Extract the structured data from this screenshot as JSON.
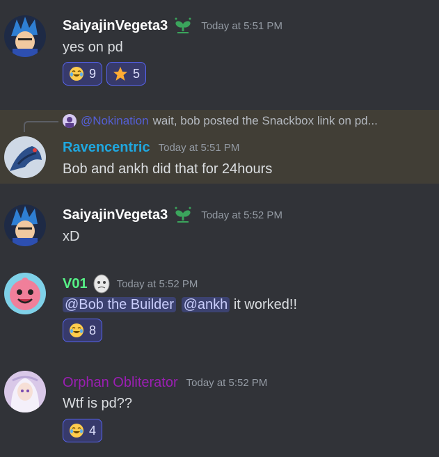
{
  "messages": [
    {
      "username": "SaiyajinVegeta3",
      "timestamp": "Today at 5:51 PM",
      "content": "yes on pd",
      "reactions": [
        {
          "emoji": "joy-emoji",
          "count": "9"
        },
        {
          "emoji": "star-emoji",
          "count": "5"
        }
      ]
    },
    {
      "reply": {
        "mention": "@Nokination",
        "text": "wait, bob posted the Snackbox link on pd..."
      },
      "username": "Ravencentric",
      "timestamp": "Today at 5:51 PM",
      "content": "Bob and ankh did that for 24hours"
    },
    {
      "username": "SaiyajinVegeta3",
      "timestamp": "Today at 5:52 PM",
      "content": "xD"
    },
    {
      "username": "V01",
      "timestamp": "Today at 5:52 PM",
      "mentions": [
        "@Bob the Builder",
        "@ankh"
      ],
      "content": "it worked!!",
      "reactions": [
        {
          "emoji": "joy-emoji",
          "count": "8"
        }
      ]
    },
    {
      "username": "Orphan Obliterator",
      "timestamp": "Today at 5:52 PM",
      "content": "Wtf is pd??",
      "reactions": [
        {
          "emoji": "joy-emoji",
          "count": "4"
        }
      ]
    }
  ],
  "colors": {
    "background": "#313338",
    "highlight": "#413e36",
    "saiyajin": "#ffffff",
    "ravencentric": "#1fa8e0",
    "v01": "#57f287",
    "orphan": "#9b1fb3",
    "reaction_bg": "#373a6b",
    "reaction_border": "#5865f2"
  }
}
